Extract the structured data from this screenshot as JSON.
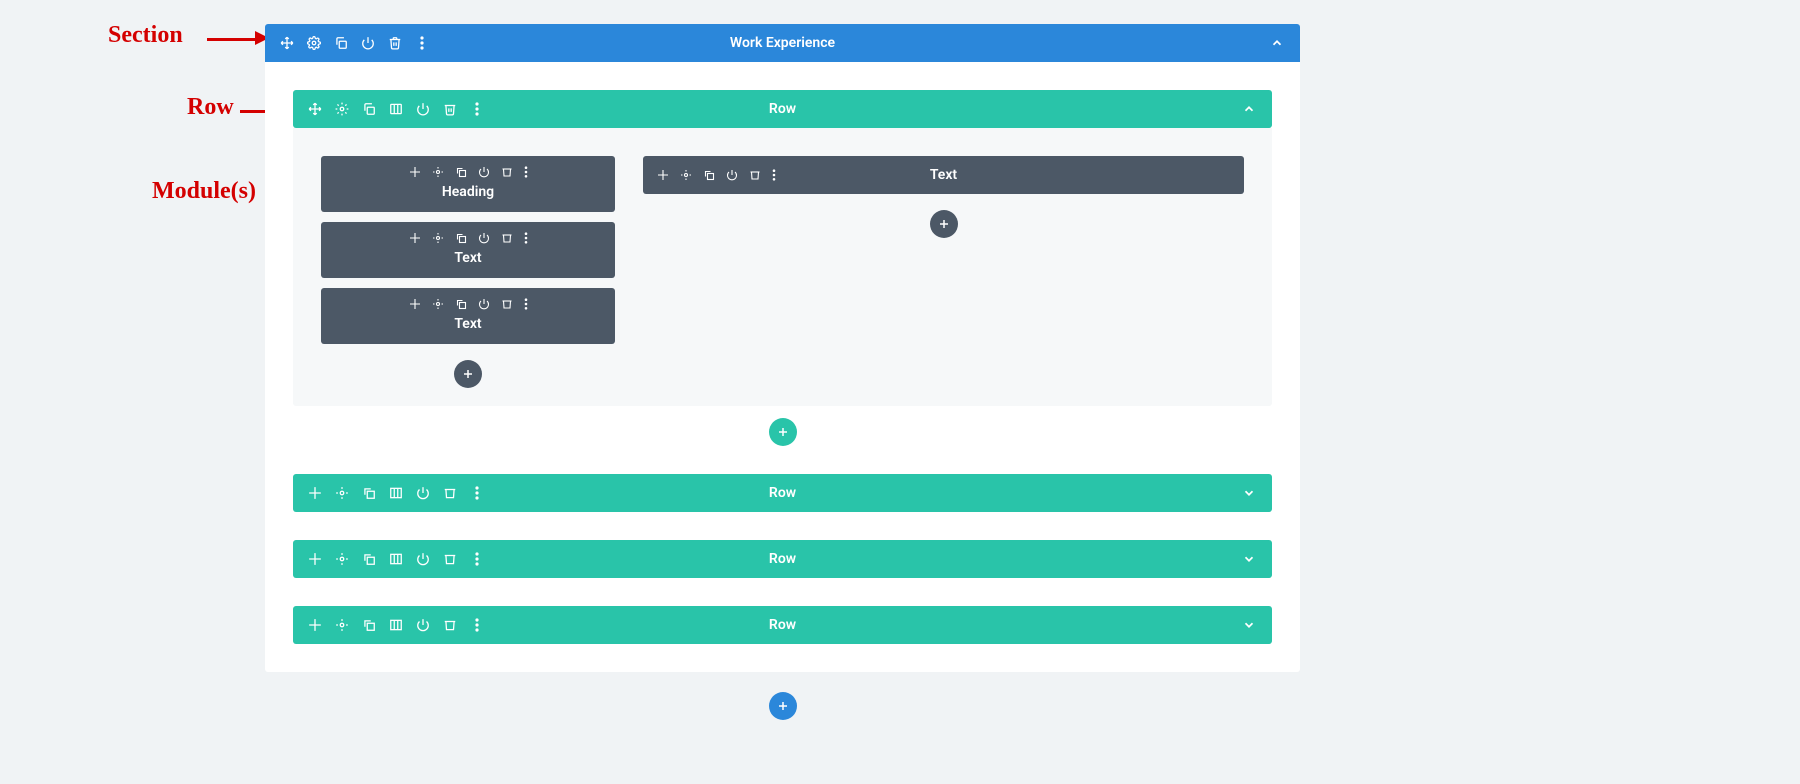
{
  "annotations": {
    "section": "Section",
    "row": "Row",
    "modules": "Module(s)"
  },
  "section": {
    "title": "Work Experience"
  },
  "rows": {
    "open": {
      "label": "Row"
    },
    "collapsed": [
      {
        "label": "Row"
      },
      {
        "label": "Row"
      },
      {
        "label": "Row"
      }
    ]
  },
  "modules": {
    "left": [
      {
        "label": "Heading"
      },
      {
        "label": "Text"
      },
      {
        "label": "Text"
      }
    ],
    "right": [
      {
        "label": "Text"
      }
    ]
  },
  "icons": {
    "move": "move-icon",
    "gear": "gear-icon",
    "duplicate": "duplicate-icon",
    "columns": "columns-icon",
    "power": "power-icon",
    "trash": "trash-icon",
    "more": "more-icon",
    "chevronUp": "chevron-up-icon",
    "chevronDown": "chevron-down-icon",
    "plus": "plus-icon"
  }
}
